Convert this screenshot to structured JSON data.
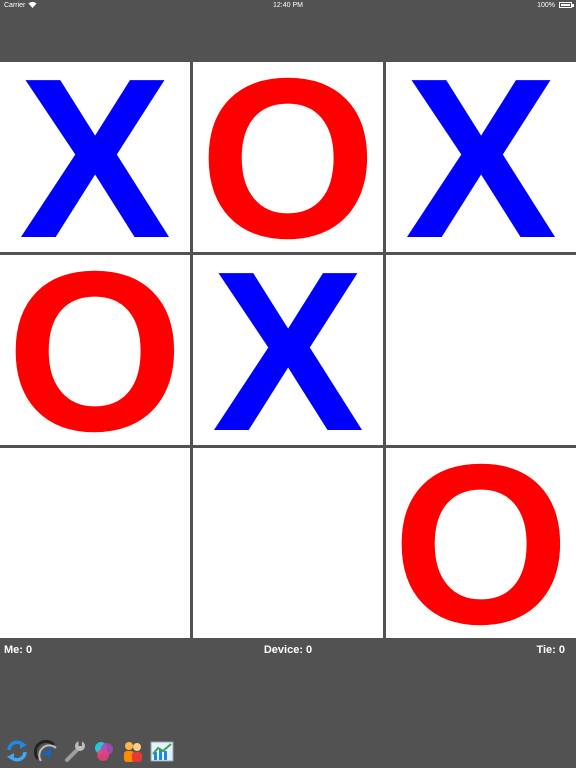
{
  "status_bar": {
    "carrier": "Carrier",
    "wifi_icon": "wifi-icon",
    "time": "12:40 PM",
    "battery": "100%"
  },
  "board": {
    "cells": [
      {
        "mark": "X"
      },
      {
        "mark": "O"
      },
      {
        "mark": "X"
      },
      {
        "mark": "O"
      },
      {
        "mark": "X"
      },
      {
        "mark": ""
      },
      {
        "mark": ""
      },
      {
        "mark": ""
      },
      {
        "mark": "O"
      }
    ],
    "colors": {
      "x": "#0000ff",
      "o": "#ff0000",
      "background": "#525252",
      "cell": "#ffffff"
    }
  },
  "scores": {
    "me": "Me: 0",
    "device": "Device: 0",
    "tie": "Tie: 0"
  },
  "toolbar": {
    "icons": [
      "refresh-icon",
      "sound-icon",
      "settings-wrench-icon",
      "color-theme-icon",
      "players-icon",
      "stats-chart-icon"
    ]
  }
}
